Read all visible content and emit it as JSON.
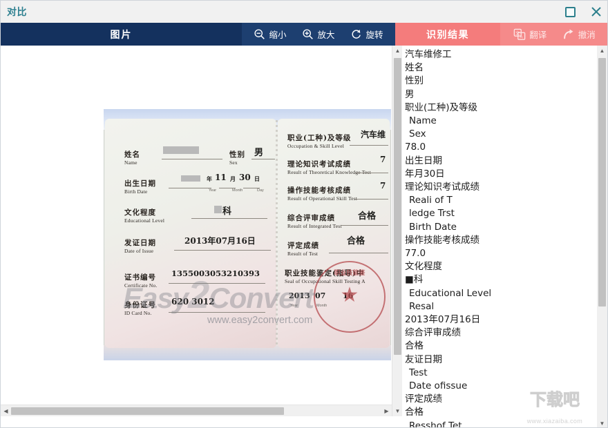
{
  "window": {
    "title": "对比",
    "maximize_label": "maximize",
    "close_label": "close",
    "accent_teal": "#2c7f8c",
    "navy": "#14315e",
    "navy_light": "#1d3f70",
    "coral": "#f47c7c",
    "coral_light": "#f58a8a"
  },
  "toolbar": {
    "image_panel_title": "图片",
    "tools": [
      {
        "icon": "zoom-out-icon",
        "label": "缩小"
      },
      {
        "icon": "zoom-in-icon",
        "label": "放大"
      },
      {
        "icon": "rotate-icon",
        "label": "旋转"
      }
    ],
    "result_panel_title": "识别结果",
    "result_tools": [
      {
        "icon": "translate-icon",
        "label": "翻译"
      },
      {
        "icon": "undo-icon",
        "label": "撤消"
      }
    ]
  },
  "certificate": {
    "left_page": {
      "fields": [
        {
          "cn": "姓名",
          "en": "Name",
          "value": "",
          "redacted": true
        },
        {
          "cn": "性别",
          "en": "Sex",
          "value": "男"
        },
        {
          "cn": "出生日期",
          "en": "Birth Date",
          "value": "年 11 月 30 日",
          "redacted": true
        },
        {
          "cn": "文化程度",
          "en": "Educational Level",
          "value": "科"
        },
        {
          "cn": "发证日期",
          "en": "Date of Issue",
          "value": "2013年07月16日"
        },
        {
          "cn": "证书编号",
          "en": "Certificate No.",
          "value": "1355003053210393"
        },
        {
          "cn": "身份证号",
          "en": "ID Card No.",
          "value": "620          3012"
        }
      ],
      "date_units": [
        "Year",
        "Month",
        "Day"
      ]
    },
    "right_page": {
      "fields": [
        {
          "cn": "职业(工种)及等级",
          "en": "Occupation & Skill Level",
          "value": "汽车维"
        },
        {
          "cn": "理论知识考试成绩",
          "en": "Result of Theoretical Knowledge Test",
          "value": "7"
        },
        {
          "cn": "操作技能考核成绩",
          "en": "Result of Operational Skill Test",
          "value": "7"
        },
        {
          "cn": "综合评审成绩",
          "en": "Result of Integrated Test",
          "value": "合格"
        },
        {
          "cn": "评定成绩",
          "en": "Result of Test",
          "value": "合格"
        },
        {
          "cn": "职业技能鉴定(指导)中",
          "en": "Seal of Occupational Skill Testing A",
          "value": ""
        }
      ],
      "seal_date": {
        "year": "2013",
        "month": "07",
        "day": "16"
      },
      "seal_text": "职业技能鉴"
    },
    "watermark_brand": "Easy",
    "watermark_brand_big": "2",
    "watermark_brand_tail": "Convert",
    "watermark_url": "www.easy2convert.com"
  },
  "results": {
    "lines": [
      {
        "text": "汽车维修工",
        "indent": false
      },
      {
        "text": "姓名",
        "indent": false
      },
      {
        "text": "性别",
        "indent": false
      },
      {
        "text": "男",
        "indent": false
      },
      {
        "text": "职业(工种)及等级",
        "indent": false
      },
      {
        "text": "Name",
        "indent": true
      },
      {
        "text": "Sex",
        "indent": true
      },
      {
        "text": "78.0",
        "indent": false
      },
      {
        "text": "出生日期",
        "indent": false
      },
      {
        "text": "年月30日",
        "indent": false
      },
      {
        "text": "理论知识考试成绩",
        "indent": false
      },
      {
        "text": "Reali of T",
        "indent": true
      },
      {
        "text": "ledge Trst",
        "indent": true
      },
      {
        "text": "Birth Date",
        "indent": true
      },
      {
        "text": "操作技能考核成绩",
        "indent": false
      },
      {
        "text": "77.0",
        "indent": false
      },
      {
        "text": "文化程度",
        "indent": false
      },
      {
        "text": "■科",
        "indent": false
      },
      {
        "text": "Educational Level",
        "indent": true
      },
      {
        "text": "Resal",
        "indent": true
      },
      {
        "text": "2013年07月16日",
        "indent": false
      },
      {
        "text": "综合评审成绩",
        "indent": false
      },
      {
        "text": "合格",
        "indent": false
      },
      {
        "text": "友证日期",
        "indent": false
      },
      {
        "text": "Test",
        "indent": true
      },
      {
        "text": "Date ofissue",
        "indent": true
      },
      {
        "text": "评定成绩",
        "indent": false
      },
      {
        "text": "合格",
        "indent": false
      },
      {
        "text": "Resshof Tet",
        "indent": true
      }
    ]
  },
  "scrollbars": {
    "up_arrow": "▲",
    "down_arrow": "▼",
    "left_arrow": "◀",
    "right_arrow": "▶"
  },
  "site_watermark": {
    "text": "下载吧",
    "url": "www.xiazaiba.com"
  }
}
